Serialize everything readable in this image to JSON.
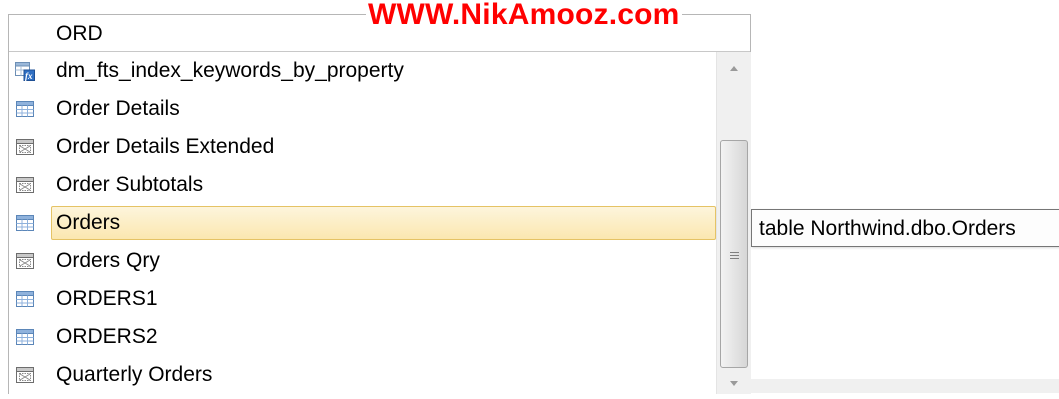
{
  "watermark": "WWW.NikAmooz.com",
  "input": {
    "typed_text": "ORD"
  },
  "completion_list": {
    "items": [
      {
        "label": "dm_fts_index_keywords_by_property",
        "icon": "function-icon",
        "selected": false
      },
      {
        "label": "Order Details",
        "icon": "table-icon",
        "selected": false
      },
      {
        "label": "Order Details Extended",
        "icon": "view-icon",
        "selected": false
      },
      {
        "label": "Order Subtotals",
        "icon": "view-icon",
        "selected": false
      },
      {
        "label": "Orders",
        "icon": "table-icon",
        "selected": true
      },
      {
        "label": "Orders Qry",
        "icon": "view-icon",
        "selected": false
      },
      {
        "label": "ORDERS1",
        "icon": "table-icon",
        "selected": false
      },
      {
        "label": "ORDERS2",
        "icon": "table-icon",
        "selected": false
      },
      {
        "label": "Quarterly Orders",
        "icon": "view-icon",
        "selected": false
      }
    ]
  },
  "tooltip": {
    "text": "table Northwind.dbo.Orders"
  },
  "colors": {
    "watermark": "#ff0000",
    "selection_border": "#e5c365",
    "selection_fill": "#fbe7b0"
  }
}
